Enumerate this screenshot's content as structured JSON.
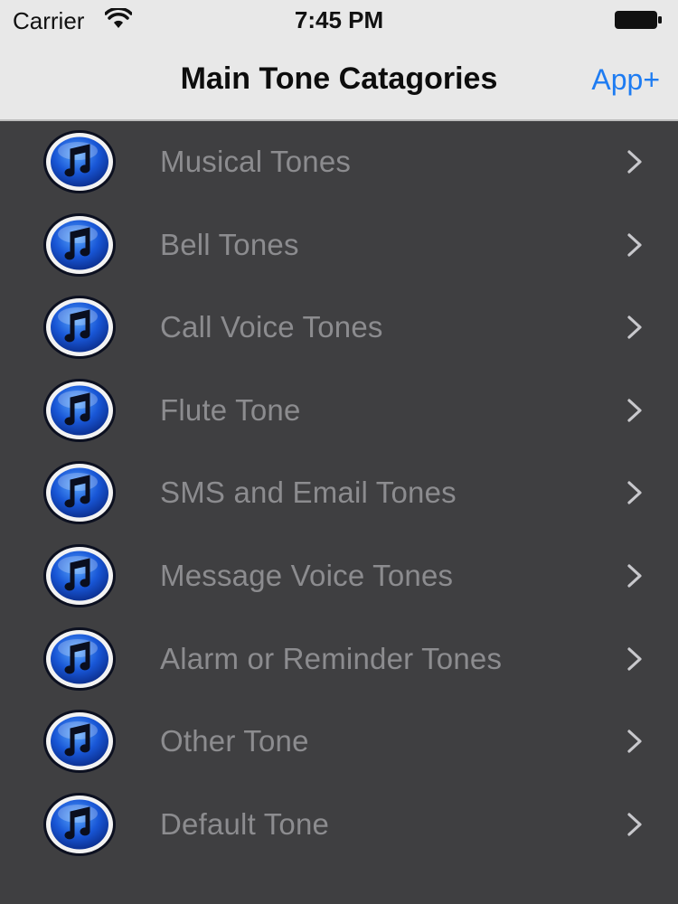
{
  "status_bar": {
    "carrier": "Carrier",
    "time": "7:45 PM",
    "wifi_icon": "wifi-icon",
    "battery_icon": "battery-icon"
  },
  "nav_bar": {
    "title": "Main Tone Catagories",
    "right_button": "App+",
    "accent_color": "#1e7cf2"
  },
  "list": {
    "background": "#3f3f41",
    "icon": "music-note-icon",
    "chevron_icon": "chevron-right-icon",
    "items": [
      {
        "label": "Musical Tones"
      },
      {
        "label": "Bell Tones"
      },
      {
        "label": "Call Voice Tones"
      },
      {
        "label": "Flute Tone"
      },
      {
        "label": "SMS and Email Tones"
      },
      {
        "label": "Message Voice Tones"
      },
      {
        "label": "Alarm or Reminder Tones"
      },
      {
        "label": "Other Tone"
      },
      {
        "label": "Default Tone"
      }
    ]
  }
}
